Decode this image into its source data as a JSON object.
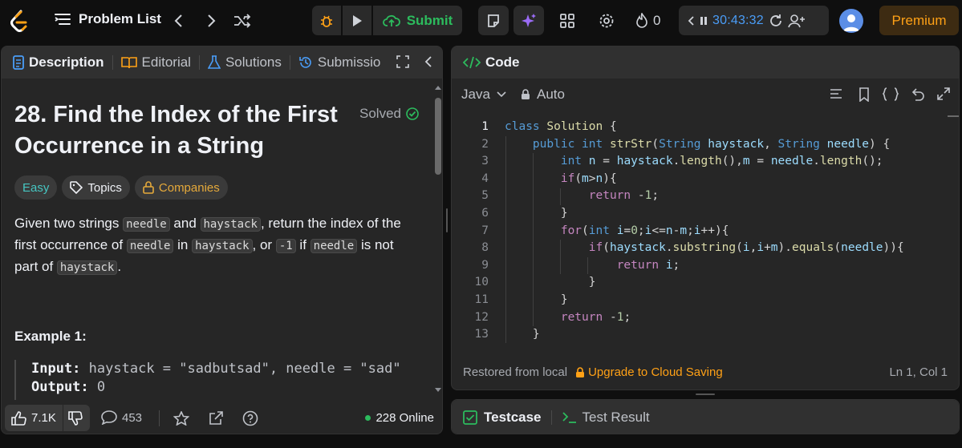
{
  "header": {
    "problem_list_label": "Problem List",
    "submit_label": "Submit",
    "streak_count": "0",
    "timer": "30:43:32",
    "premium_label": "Premium"
  },
  "left_tabs": [
    "Description",
    "Editorial",
    "Solutions",
    "Submissio"
  ],
  "problem": {
    "title": "28. Find the Index of the First Occurrence in a String",
    "status": "Solved",
    "difficulty": "Easy",
    "topics_label": "Topics",
    "companies_label": "Companies",
    "desc_1": "Given two strings ",
    "code_needle": "needle",
    "desc_2": " and ",
    "code_haystack": "haystack",
    "desc_3": ", return the index of the first occurrence of ",
    "desc_4": " in ",
    "desc_5": ", or ",
    "code_minus1": "-1",
    "desc_6": " if ",
    "desc_7": " is not part of ",
    "desc_8": ".",
    "example_heading": "Example 1:",
    "example_input_label": "Input:",
    "example_input_value": "haystack = \"sadbutsad\", needle = \"sad\"",
    "example_output_label": "Output:",
    "example_output_value": "0"
  },
  "footer_left": {
    "likes": "7.1K",
    "comments": "453",
    "online": "228 Online"
  },
  "code_panel": {
    "title": "Code",
    "language": "Java",
    "mode": "Auto",
    "status_left": "Restored from local",
    "upgrade": "Upgrade to Cloud Saving",
    "cursor": "Ln 1, Col 1"
  },
  "code_lines": [
    "1",
    "2",
    "3",
    "4",
    "5",
    "6",
    "7",
    "8",
    "9",
    "10",
    "11",
    "12",
    "13"
  ],
  "testcase": {
    "tab1": "Testcase",
    "tab2": "Test Result"
  },
  "colors": {
    "accent_orange": "#ffa116",
    "submit_green": "#2cbb5d",
    "timer_blue": "#4a9df8",
    "easy_teal": "#46c6c2"
  }
}
